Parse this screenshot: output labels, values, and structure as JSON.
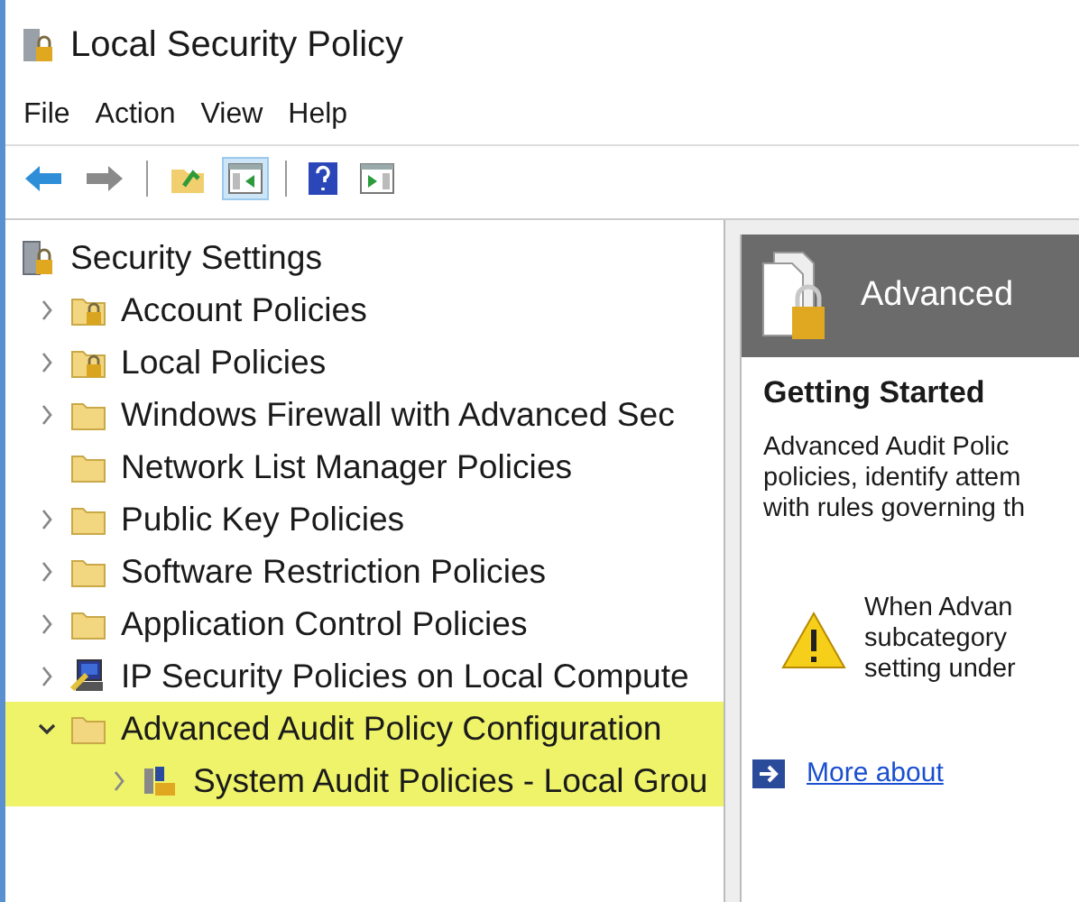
{
  "window": {
    "title": "Local Security Policy"
  },
  "menu": [
    "File",
    "Action",
    "View",
    "Help"
  ],
  "toolbar": [
    {
      "kind": "back",
      "selected": false
    },
    {
      "kind": "forward",
      "selected": false
    },
    {
      "kind": "separator",
      "selected": false
    },
    {
      "kind": "up",
      "selected": false
    },
    {
      "kind": "tree-toggle",
      "selected": true
    },
    {
      "kind": "separator",
      "selected": false
    },
    {
      "kind": "help",
      "selected": false
    },
    {
      "kind": "action-pane",
      "selected": false
    }
  ],
  "tree": {
    "label": "Security Settings",
    "kind": "root",
    "children": [
      {
        "label": "Account Policies",
        "kind": "locked-folder",
        "expanded": false,
        "highlighted": false
      },
      {
        "label": "Local Policies",
        "kind": "locked-folder",
        "expanded": false,
        "highlighted": false
      },
      {
        "label": "Windows Firewall with Advanced Sec",
        "kind": "folder",
        "expanded": false,
        "highlighted": false
      },
      {
        "label": "Network List Manager Policies",
        "kind": "folder",
        "highlighted": false
      },
      {
        "label": "Public Key Policies",
        "kind": "folder",
        "expanded": false,
        "highlighted": false
      },
      {
        "label": "Software Restriction Policies",
        "kind": "folder",
        "expanded": false,
        "highlighted": false
      },
      {
        "label": "Application Control Policies",
        "kind": "folder",
        "expanded": false,
        "highlighted": false
      },
      {
        "label": "IP Security Policies on Local Compute",
        "kind": "computer",
        "expanded": false,
        "highlighted": false
      },
      {
        "label": "Advanced Audit Policy Configuration",
        "kind": "folder",
        "expanded": true,
        "highlighted": true,
        "children": [
          {
            "label": "System Audit Policies - Local Grou",
            "kind": "audit",
            "expanded": false,
            "highlighted": true
          }
        ]
      }
    ]
  },
  "details": {
    "header": "Advanced",
    "section_title": "Getting Started",
    "description_lines": [
      "Advanced Audit Polic",
      "policies, identify attem",
      "with rules governing th"
    ],
    "warning_lines": [
      "When Advan",
      "subcategory",
      "setting under"
    ],
    "link": "More about"
  }
}
